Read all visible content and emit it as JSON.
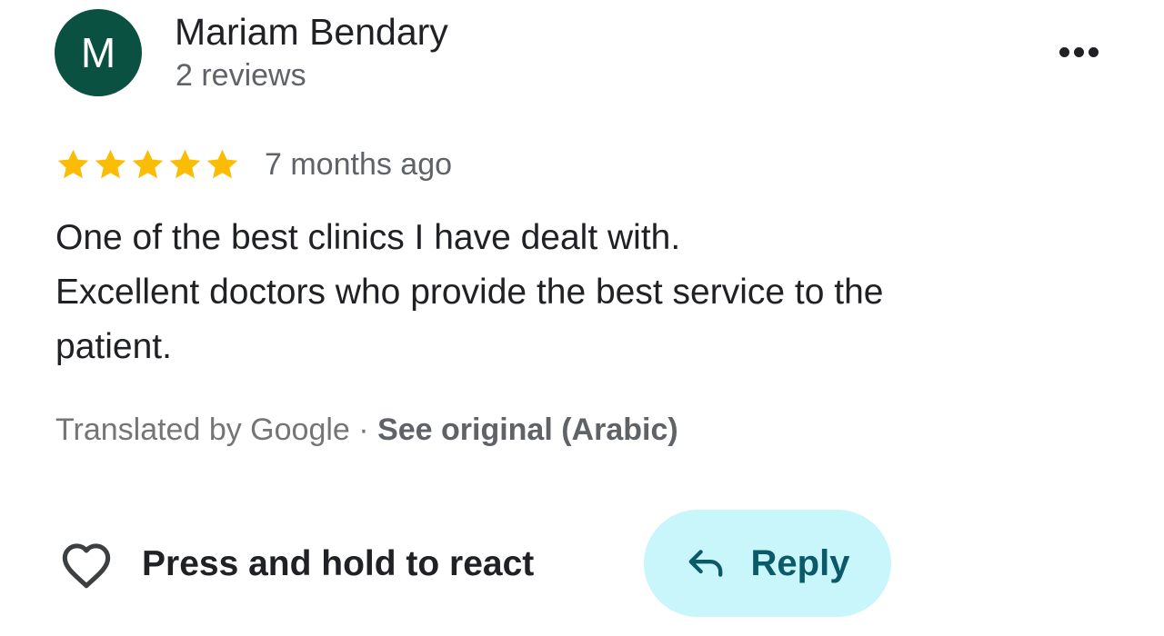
{
  "author": {
    "initial": "M",
    "name": "Mariam Bendary",
    "meta": "2 reviews",
    "avatar_color": "#0b5141"
  },
  "rating": {
    "stars": 5,
    "max_stars": 5,
    "star_color": "#fbbc04",
    "time_ago": "7 months ago"
  },
  "review": {
    "lines": [
      "One of the best clinics I have dealt with.",
      "Excellent doctors who provide the best service to the",
      "patient."
    ]
  },
  "translation": {
    "label": "Translated by Google",
    "separator": "·",
    "link": "See original (Arabic)"
  },
  "actions": {
    "react_icon": "heart-outline-icon",
    "react_label": "Press and hold to react",
    "reply_icon": "reply-arrow-icon",
    "reply_label": "Reply",
    "reply_bg": "#c9f6fb",
    "reply_color": "#0b5a67"
  },
  "menu": {
    "icon": "more-horizontal-icon"
  }
}
